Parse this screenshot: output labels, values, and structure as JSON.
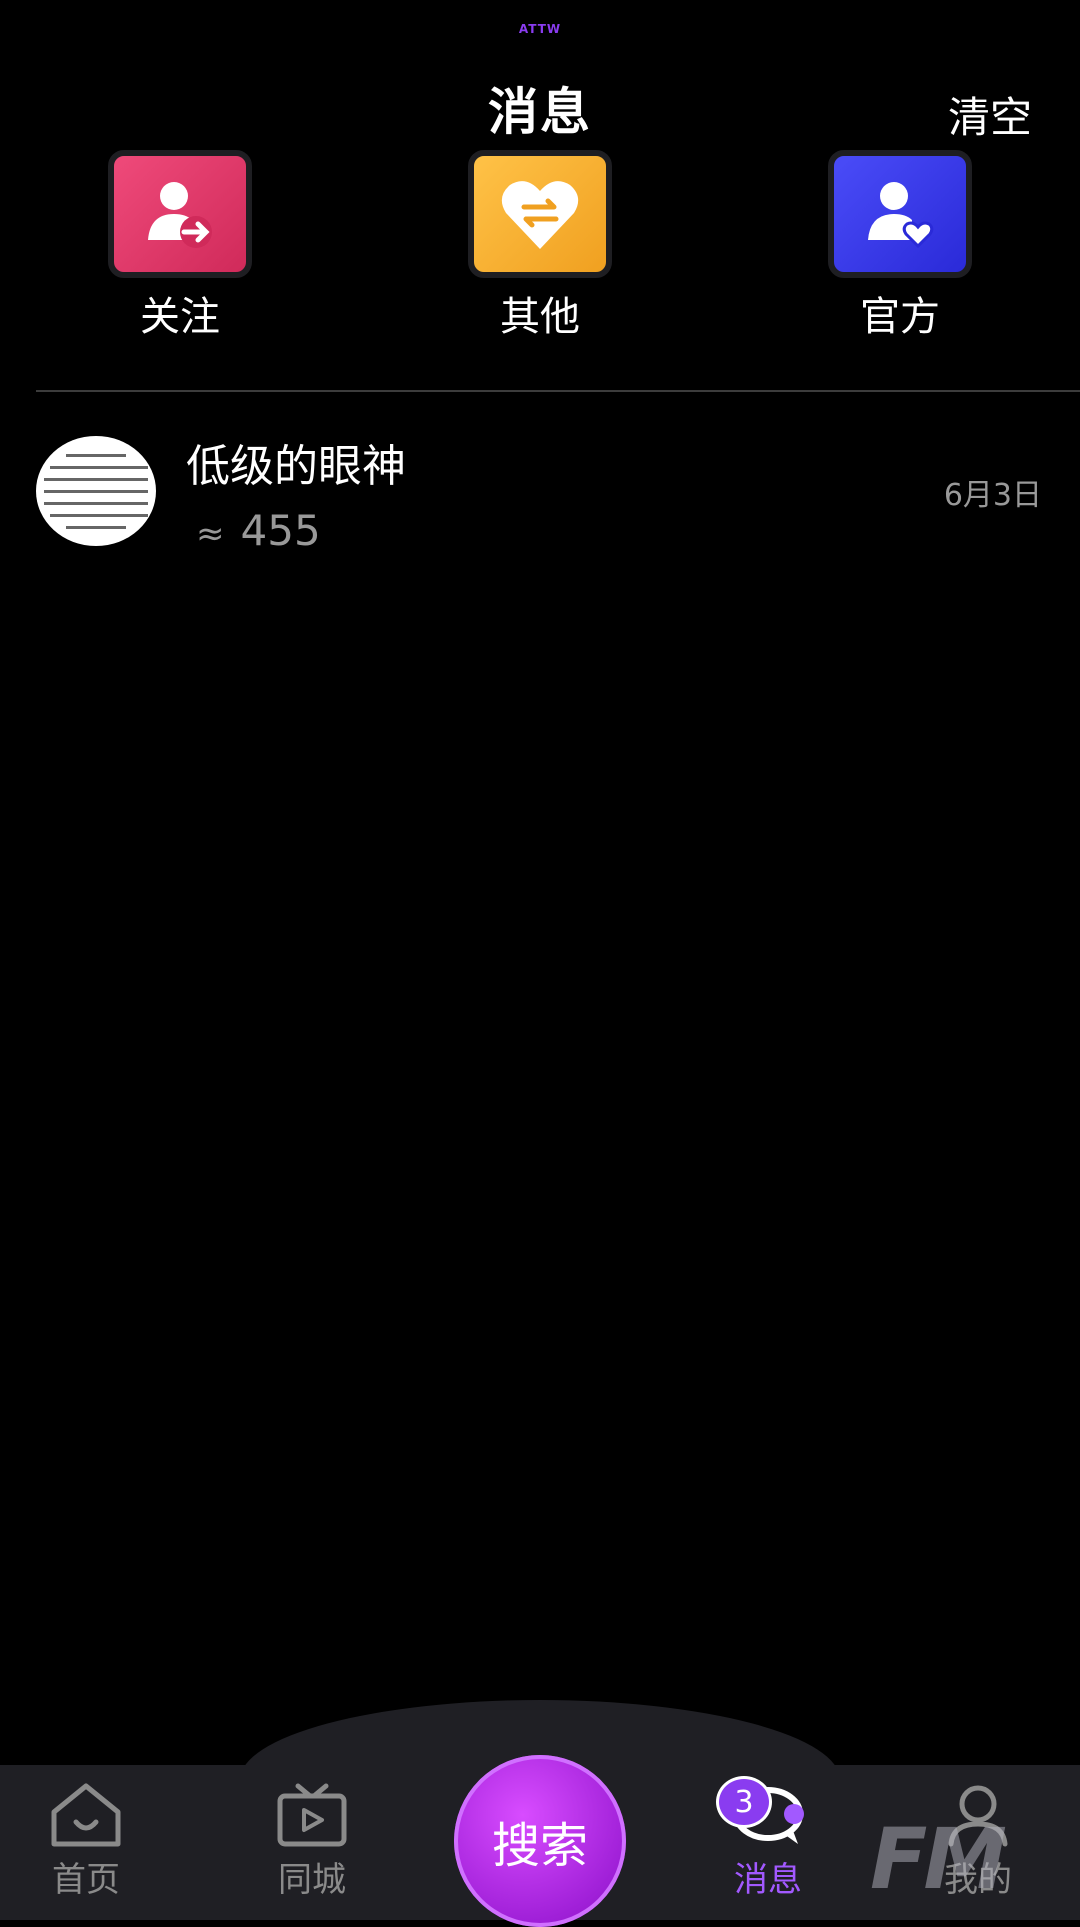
{
  "status": {
    "mark": "ATTW"
  },
  "header": {
    "title": "消息",
    "clear_label": "清空"
  },
  "categories": [
    {
      "label": "关注",
      "icon": "user-follow-icon",
      "color": "#e63a6e"
    },
    {
      "label": "其他",
      "icon": "heart-exchange-icon",
      "color": "#f6b133"
    },
    {
      "label": "官方",
      "icon": "user-heart-icon",
      "color": "#3436ee"
    }
  ],
  "messages": [
    {
      "name": "低级的眼神",
      "preview": "455",
      "preview_icon": "voice-wave-icon",
      "date": "6月3日"
    }
  ],
  "tabbar": {
    "tabs": [
      {
        "label": "首页",
        "icon": "home-icon"
      },
      {
        "label": "同城",
        "icon": "tv-play-icon"
      },
      {
        "label": "搜索",
        "icon": "search-center-button"
      },
      {
        "label": "消息",
        "icon": "chat-bubble-icon",
        "badge": "3",
        "active": true
      },
      {
        "label": "我的",
        "icon": "profile-icon"
      }
    ]
  },
  "watermark": "FM",
  "colors": {
    "accent": "#a259ff",
    "background": "#000000",
    "tabbar": "#1f1f24"
  }
}
